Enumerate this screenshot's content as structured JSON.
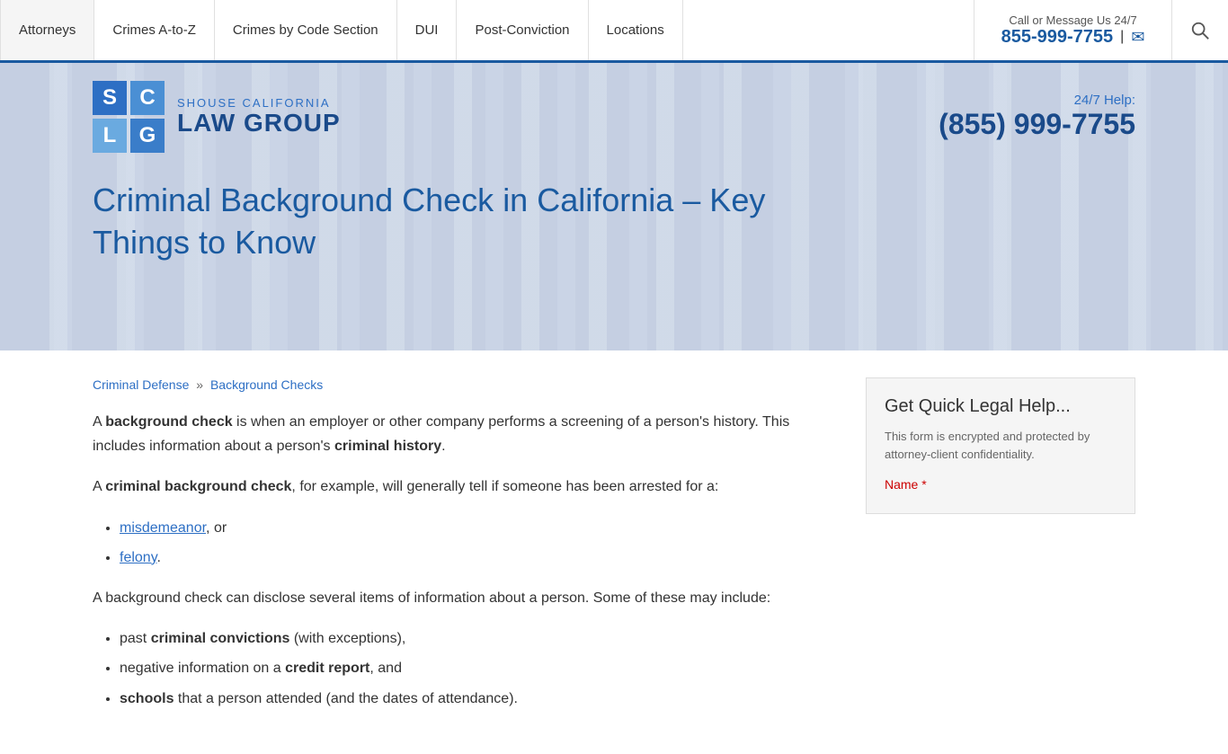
{
  "nav": {
    "items": [
      {
        "label": "Attorneys",
        "id": "attorneys"
      },
      {
        "label": "Crimes A-to-Z",
        "id": "crimes-az"
      },
      {
        "label": "Crimes by Code Section",
        "id": "crimes-code"
      },
      {
        "label": "DUI",
        "id": "dui"
      },
      {
        "label": "Post-Conviction",
        "id": "post-conviction"
      },
      {
        "label": "Locations",
        "id": "locations"
      }
    ],
    "contact_label": "Call or Message Us 24/7",
    "contact_phone": "855-999-7755",
    "contact_separator": "|"
  },
  "logo": {
    "cells": [
      "S",
      "C",
      "L",
      "G"
    ],
    "text_top": "SHOUSE CALIFORNIA",
    "text_bottom": "LAW GROUP"
  },
  "phone": {
    "label": "24/7 Help:",
    "number": "(855) 999-7755"
  },
  "page_title": "Criminal Background Check in California – Key Things to Know",
  "breadcrumb": {
    "items": [
      {
        "label": "Criminal Defense",
        "href": "#"
      },
      {
        "label": "Background Checks",
        "href": "#"
      }
    ],
    "separator": "»"
  },
  "article": {
    "para1_prefix": "A ",
    "para1_bold1": "background check",
    "para1_middle": " is when an employer or other company performs a screening of a person's history. This includes information about a person's ",
    "para1_bold2": "criminal history",
    "para1_suffix": ".",
    "para2_prefix": "A ",
    "para2_bold": "criminal background check",
    "para2_suffix": ", for example, will generally tell if someone has been arrested for a:",
    "list1": [
      {
        "text": "misdemeanor",
        "link": true,
        "suffix": ", or"
      },
      {
        "text": "felony",
        "link": true,
        "suffix": "."
      }
    ],
    "para3": "A background check can disclose several items of information about a person. Some of these may include:",
    "list2": [
      {
        "prefix": "past ",
        "bold": "criminal convictions",
        "suffix": " (with exceptions),"
      },
      {
        "prefix": "negative information on a ",
        "bold": "credit report",
        "suffix": ", and"
      },
      {
        "prefix": "",
        "bold": "schools",
        "suffix": " that a person attended (and the dates of attendance)."
      }
    ]
  },
  "sidebar": {
    "form_title": "Get Quick Legal Help...",
    "form_subtitle": "This form is encrypted and protected by attorney-client confidentiality.",
    "name_label": "Name",
    "name_required": "*"
  }
}
